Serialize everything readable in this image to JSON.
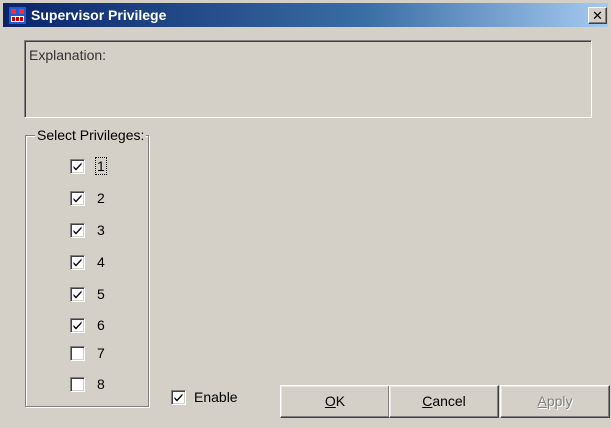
{
  "window": {
    "title": "Supervisor Privilege",
    "close_glyph": "✕"
  },
  "explanation": {
    "label": "Explanation:"
  },
  "privileges": {
    "group_label": "Select Privileges:",
    "items": [
      {
        "label": "1",
        "checked": true,
        "focused": true
      },
      {
        "label": "2",
        "checked": true
      },
      {
        "label": "3",
        "checked": true
      },
      {
        "label": "4",
        "checked": true
      },
      {
        "label": "5",
        "checked": true
      },
      {
        "label": "6",
        "checked": true
      },
      {
        "label": "7",
        "checked": false
      },
      {
        "label": "8",
        "checked": false
      }
    ]
  },
  "enable": {
    "label": "Enable",
    "checked": true
  },
  "buttons": {
    "ok": {
      "accel": "O",
      "rest": "K"
    },
    "cancel": {
      "accel": "C",
      "rest": "ancel"
    },
    "apply": {
      "accel": "A",
      "rest": "pply",
      "disabled": true
    }
  },
  "icons": {
    "app": "app-icon",
    "close": "close-icon",
    "check": "checkmark-icon"
  }
}
